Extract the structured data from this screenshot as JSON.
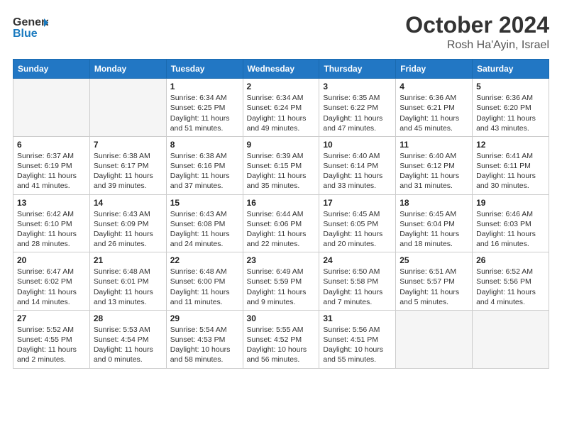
{
  "header": {
    "logo_general": "General",
    "logo_blue": "Blue",
    "month_year": "October 2024",
    "location": "Rosh Ha'Ayin, Israel"
  },
  "days_of_week": [
    "Sunday",
    "Monday",
    "Tuesday",
    "Wednesday",
    "Thursday",
    "Friday",
    "Saturday"
  ],
  "weeks": [
    [
      {
        "day": "",
        "sunrise": "",
        "sunset": "",
        "daylight": ""
      },
      {
        "day": "",
        "sunrise": "",
        "sunset": "",
        "daylight": ""
      },
      {
        "day": "1",
        "sunrise": "Sunrise: 6:34 AM",
        "sunset": "Sunset: 6:25 PM",
        "daylight": "Daylight: 11 hours and 51 minutes."
      },
      {
        "day": "2",
        "sunrise": "Sunrise: 6:34 AM",
        "sunset": "Sunset: 6:24 PM",
        "daylight": "Daylight: 11 hours and 49 minutes."
      },
      {
        "day": "3",
        "sunrise": "Sunrise: 6:35 AM",
        "sunset": "Sunset: 6:22 PM",
        "daylight": "Daylight: 11 hours and 47 minutes."
      },
      {
        "day": "4",
        "sunrise": "Sunrise: 6:36 AM",
        "sunset": "Sunset: 6:21 PM",
        "daylight": "Daylight: 11 hours and 45 minutes."
      },
      {
        "day": "5",
        "sunrise": "Sunrise: 6:36 AM",
        "sunset": "Sunset: 6:20 PM",
        "daylight": "Daylight: 11 hours and 43 minutes."
      }
    ],
    [
      {
        "day": "6",
        "sunrise": "Sunrise: 6:37 AM",
        "sunset": "Sunset: 6:19 PM",
        "daylight": "Daylight: 11 hours and 41 minutes."
      },
      {
        "day": "7",
        "sunrise": "Sunrise: 6:38 AM",
        "sunset": "Sunset: 6:17 PM",
        "daylight": "Daylight: 11 hours and 39 minutes."
      },
      {
        "day": "8",
        "sunrise": "Sunrise: 6:38 AM",
        "sunset": "Sunset: 6:16 PM",
        "daylight": "Daylight: 11 hours and 37 minutes."
      },
      {
        "day": "9",
        "sunrise": "Sunrise: 6:39 AM",
        "sunset": "Sunset: 6:15 PM",
        "daylight": "Daylight: 11 hours and 35 minutes."
      },
      {
        "day": "10",
        "sunrise": "Sunrise: 6:40 AM",
        "sunset": "Sunset: 6:14 PM",
        "daylight": "Daylight: 11 hours and 33 minutes."
      },
      {
        "day": "11",
        "sunrise": "Sunrise: 6:40 AM",
        "sunset": "Sunset: 6:12 PM",
        "daylight": "Daylight: 11 hours and 31 minutes."
      },
      {
        "day": "12",
        "sunrise": "Sunrise: 6:41 AM",
        "sunset": "Sunset: 6:11 PM",
        "daylight": "Daylight: 11 hours and 30 minutes."
      }
    ],
    [
      {
        "day": "13",
        "sunrise": "Sunrise: 6:42 AM",
        "sunset": "Sunset: 6:10 PM",
        "daylight": "Daylight: 11 hours and 28 minutes."
      },
      {
        "day": "14",
        "sunrise": "Sunrise: 6:43 AM",
        "sunset": "Sunset: 6:09 PM",
        "daylight": "Daylight: 11 hours and 26 minutes."
      },
      {
        "day": "15",
        "sunrise": "Sunrise: 6:43 AM",
        "sunset": "Sunset: 6:08 PM",
        "daylight": "Daylight: 11 hours and 24 minutes."
      },
      {
        "day": "16",
        "sunrise": "Sunrise: 6:44 AM",
        "sunset": "Sunset: 6:06 PM",
        "daylight": "Daylight: 11 hours and 22 minutes."
      },
      {
        "day": "17",
        "sunrise": "Sunrise: 6:45 AM",
        "sunset": "Sunset: 6:05 PM",
        "daylight": "Daylight: 11 hours and 20 minutes."
      },
      {
        "day": "18",
        "sunrise": "Sunrise: 6:45 AM",
        "sunset": "Sunset: 6:04 PM",
        "daylight": "Daylight: 11 hours and 18 minutes."
      },
      {
        "day": "19",
        "sunrise": "Sunrise: 6:46 AM",
        "sunset": "Sunset: 6:03 PM",
        "daylight": "Daylight: 11 hours and 16 minutes."
      }
    ],
    [
      {
        "day": "20",
        "sunrise": "Sunrise: 6:47 AM",
        "sunset": "Sunset: 6:02 PM",
        "daylight": "Daylight: 11 hours and 14 minutes."
      },
      {
        "day": "21",
        "sunrise": "Sunrise: 6:48 AM",
        "sunset": "Sunset: 6:01 PM",
        "daylight": "Daylight: 11 hours and 13 minutes."
      },
      {
        "day": "22",
        "sunrise": "Sunrise: 6:48 AM",
        "sunset": "Sunset: 6:00 PM",
        "daylight": "Daylight: 11 hours and 11 minutes."
      },
      {
        "day": "23",
        "sunrise": "Sunrise: 6:49 AM",
        "sunset": "Sunset: 5:59 PM",
        "daylight": "Daylight: 11 hours and 9 minutes."
      },
      {
        "day": "24",
        "sunrise": "Sunrise: 6:50 AM",
        "sunset": "Sunset: 5:58 PM",
        "daylight": "Daylight: 11 hours and 7 minutes."
      },
      {
        "day": "25",
        "sunrise": "Sunrise: 6:51 AM",
        "sunset": "Sunset: 5:57 PM",
        "daylight": "Daylight: 11 hours and 5 minutes."
      },
      {
        "day": "26",
        "sunrise": "Sunrise: 6:52 AM",
        "sunset": "Sunset: 5:56 PM",
        "daylight": "Daylight: 11 hours and 4 minutes."
      }
    ],
    [
      {
        "day": "27",
        "sunrise": "Sunrise: 5:52 AM",
        "sunset": "Sunset: 4:55 PM",
        "daylight": "Daylight: 11 hours and 2 minutes."
      },
      {
        "day": "28",
        "sunrise": "Sunrise: 5:53 AM",
        "sunset": "Sunset: 4:54 PM",
        "daylight": "Daylight: 11 hours and 0 minutes."
      },
      {
        "day": "29",
        "sunrise": "Sunrise: 5:54 AM",
        "sunset": "Sunset: 4:53 PM",
        "daylight": "Daylight: 10 hours and 58 minutes."
      },
      {
        "day": "30",
        "sunrise": "Sunrise: 5:55 AM",
        "sunset": "Sunset: 4:52 PM",
        "daylight": "Daylight: 10 hours and 56 minutes."
      },
      {
        "day": "31",
        "sunrise": "Sunrise: 5:56 AM",
        "sunset": "Sunset: 4:51 PM",
        "daylight": "Daylight: 10 hours and 55 minutes."
      },
      {
        "day": "",
        "sunrise": "",
        "sunset": "",
        "daylight": ""
      },
      {
        "day": "",
        "sunrise": "",
        "sunset": "",
        "daylight": ""
      }
    ]
  ]
}
